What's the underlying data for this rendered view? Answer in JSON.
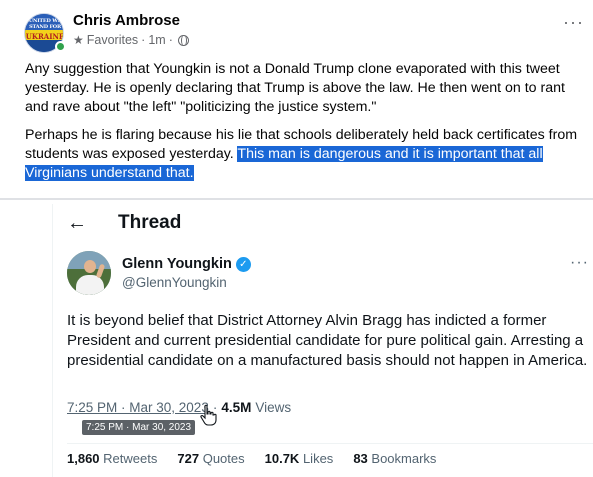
{
  "post": {
    "author": "Chris Ambrose",
    "avatar_text_top": "UNITED WE STAND FOR",
    "avatar_text_bottom": "UKRAINE",
    "audience": "Favorites",
    "separator": "·",
    "time": "1m",
    "more": "···",
    "paragraph1": "Any suggestion that Youngkin is not a Donald Trump clone evaporated with this tweet yesterday.  He is openly declaring that Trump is above the law.  He then went on to rant and rave about \"the left\" \"politicizing the justice system.\"",
    "paragraph2_plain": "Perhaps he is flaring because his lie that schools deliberately held back certificates from students was exposed yesterday. ",
    "paragraph2_selected": "This man is dangerous and it is important that all Virginians understand that."
  },
  "tweet": {
    "back_icon": "←",
    "header": "Thread",
    "author_name": "Glenn Youngkin",
    "verified_mark": "✓",
    "handle": "@GlennYoungkin",
    "more": "···",
    "text": "It is beyond belief that District Attorney Alvin Bragg has indicted a former President and current presidential candidate for pure political gain. Arresting a presidential candidate on a manufactured basis should not happen in America.",
    "timestamp": "7:25 PM · Mar 30, 2023",
    "meta_separator": "·",
    "views_count": "4.5M",
    "views_label": "Views",
    "tooltip": "7:25 PM · Mar 30, 2023",
    "stats": [
      {
        "num": "1,860",
        "label": "Retweets"
      },
      {
        "num": "727",
        "label": "Quotes"
      },
      {
        "num": "10.7K",
        "label": "Likes"
      },
      {
        "num": "83",
        "label": "Bookmarks"
      }
    ]
  },
  "colors": {
    "selection": "#1a67d6",
    "online": "#31a24c",
    "verified": "#1d9bf0",
    "secondary_text": "#65676b"
  },
  "icons": [
    "star-icon",
    "globe-icon",
    "back-arrow-icon",
    "verified-badge-icon",
    "hand-cursor-icon"
  ]
}
